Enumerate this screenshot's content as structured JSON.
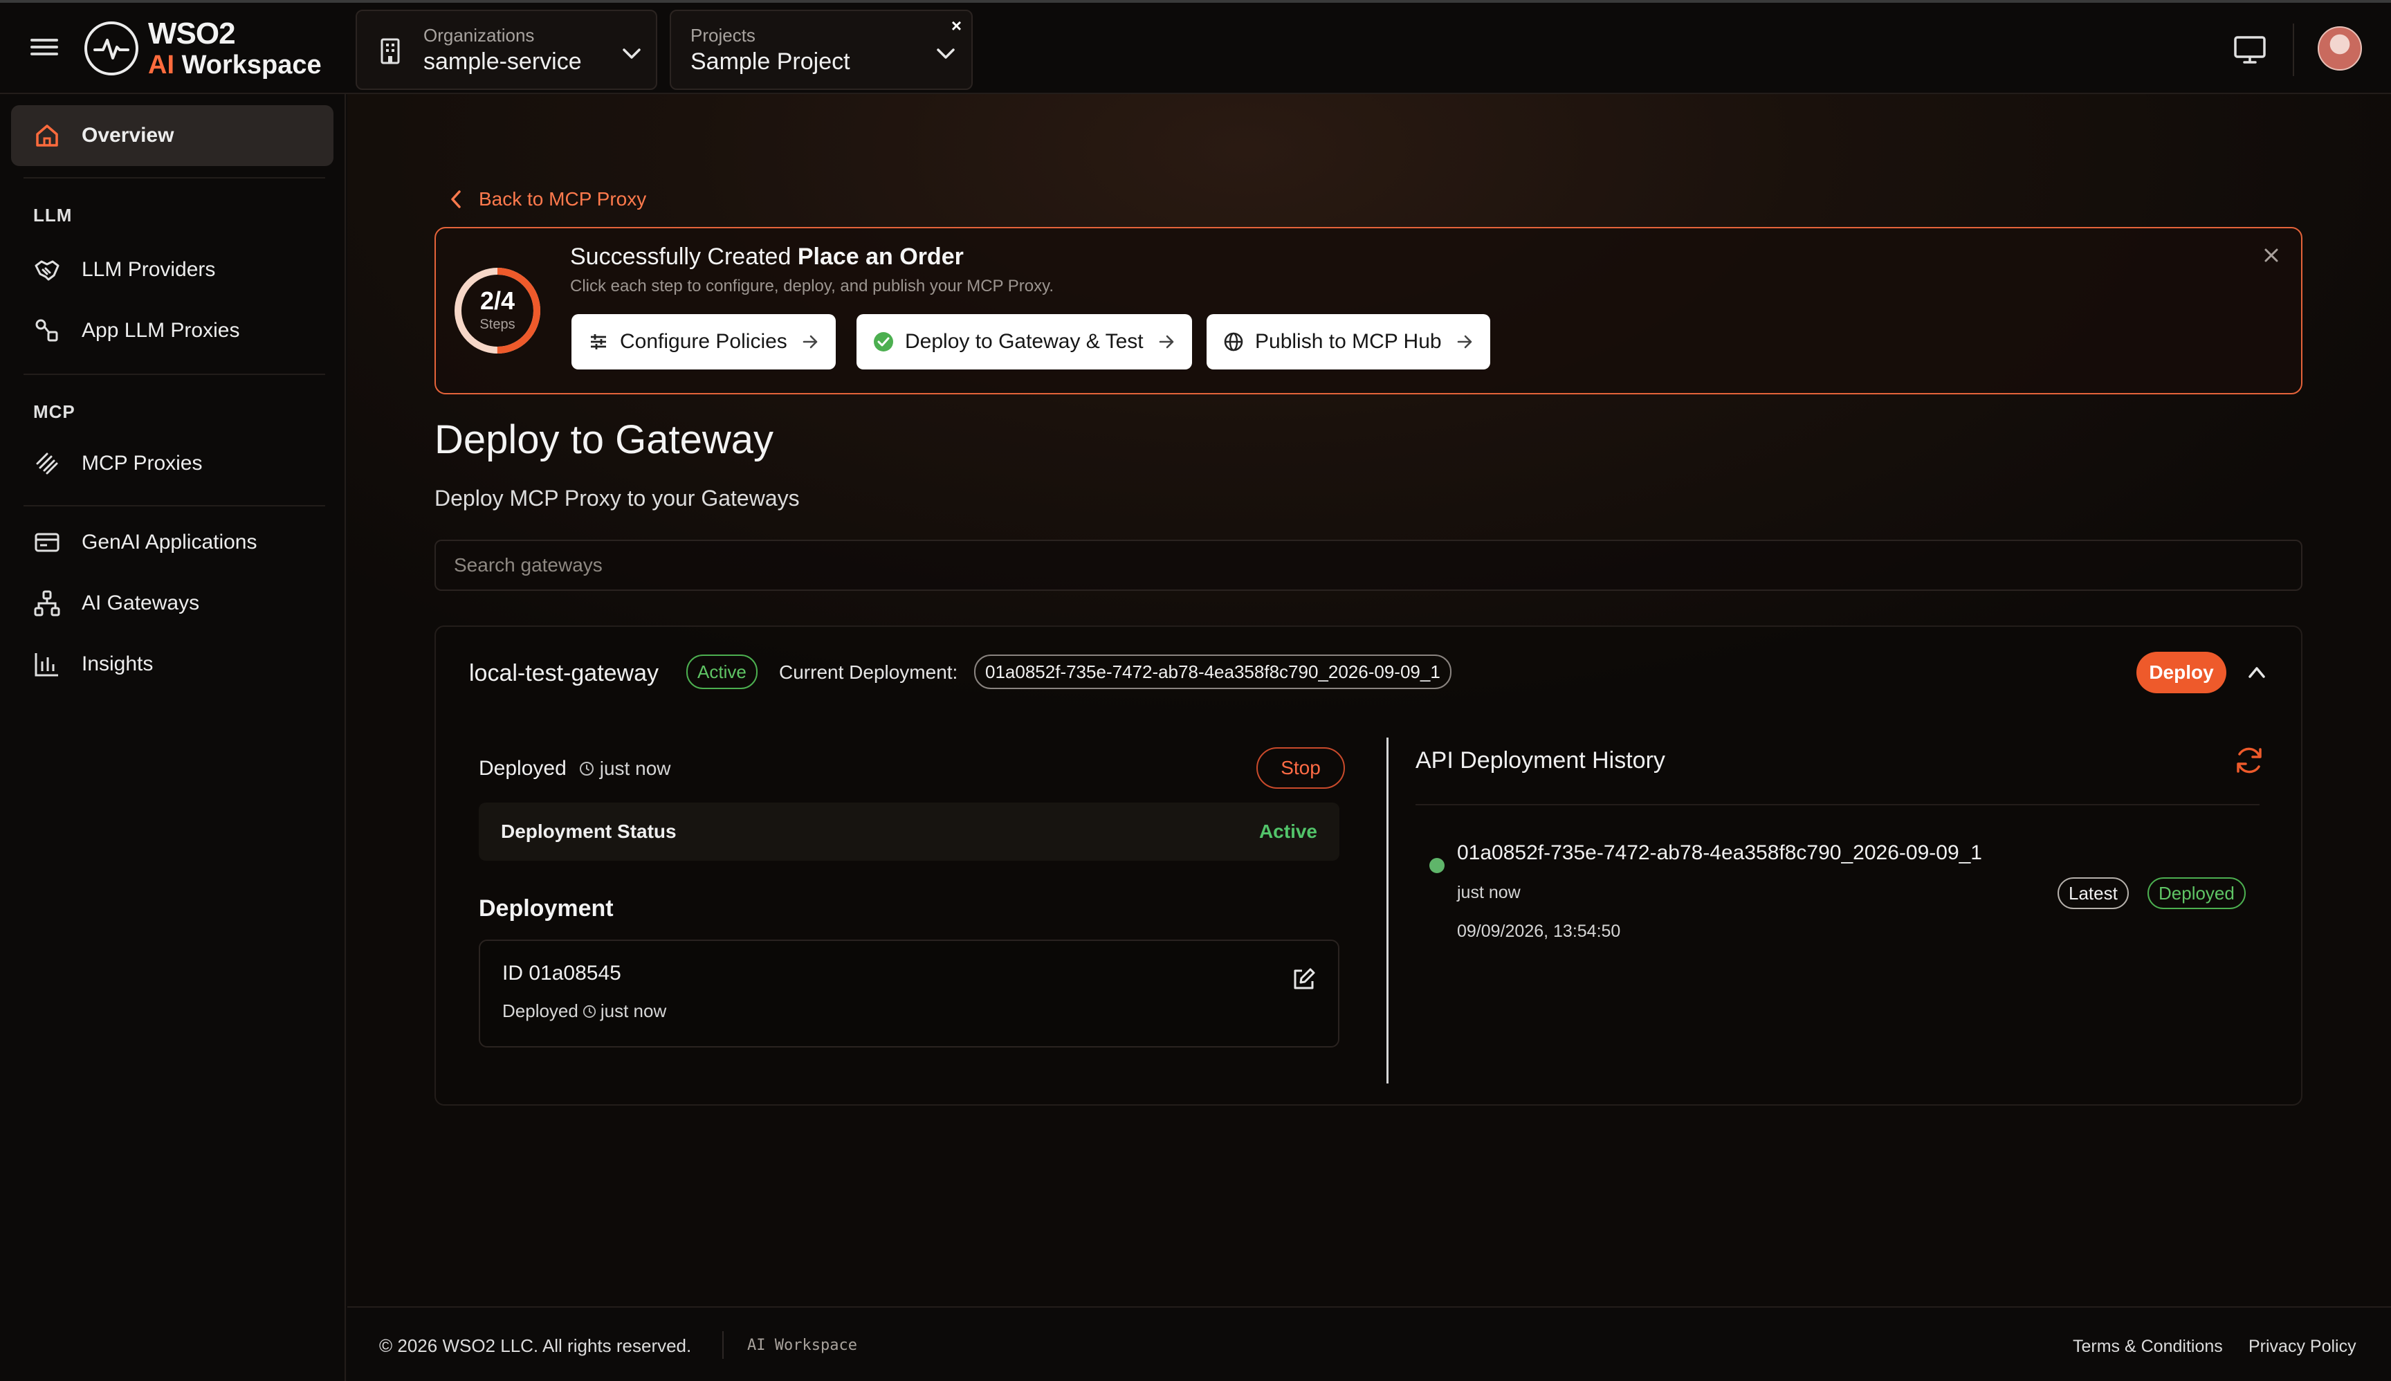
{
  "header": {
    "logo_line1": "WSO2",
    "logo_ai": "AI",
    "logo_word": "Workspace",
    "org_label": "Organizations",
    "org_value": "sample-service",
    "project_label": "Projects",
    "project_value": "Sample Project",
    "project_clear": "×"
  },
  "sidebar": {
    "overview": "Overview",
    "section_llm": "LLM",
    "llm_providers": "LLM Providers",
    "app_llm_proxies": "App LLM Proxies",
    "section_mcp": "MCP",
    "mcp_proxies": "MCP Proxies",
    "genai_applications": "GenAI Applications",
    "ai_gateways": "AI Gateways",
    "insights": "Insights"
  },
  "main": {
    "back_link": "Back to MCP Proxy",
    "banner": {
      "progress_text": "2/4",
      "progress_sub": "Steps",
      "steps_done": 2,
      "steps_total": 4,
      "title_prefix": "Successfully Created",
      "title_name": "Place an Order",
      "subtitle": "Click each step to configure, deploy, and publish your MCP Proxy.",
      "step1": "Configure Policies",
      "step2": "Deploy to Gateway & Test",
      "step3": "Publish to MCP Hub"
    },
    "page_title": "Deploy to Gateway",
    "page_subtitle": "Deploy MCP Proxy to your Gateways",
    "search_placeholder": "Search gateways",
    "gateway": {
      "name": "local-test-gateway",
      "status": "Active",
      "current_deployment_label": "Current Deployment:",
      "current_deployment_value": "01a0852f-735e-7472-ab78-4ea358f8c790_2026-09-09_1",
      "deploy_button": "Deploy",
      "deployed_label": "Deployed",
      "deployed_time": "just now",
      "stop_button": "Stop",
      "deployment_status_label": "Deployment Status",
      "deployment_status_value": "Active",
      "deployment_heading": "Deployment",
      "deployment_id": "ID 01a08545",
      "deployment_deployed_label": "Deployed",
      "deployment_deployed_time": "just now"
    },
    "history": {
      "title": "API Deployment History",
      "entry_id": "01a0852f-735e-7472-ab78-4ea358f8c790_2026-09-09_1",
      "entry_time": "just now",
      "entry_date": "09/09/2026, 13:54:50",
      "tag_latest": "Latest",
      "tag_deployed": "Deployed"
    }
  },
  "footer": {
    "copyright": "© 2026 WSO2 LLC. All rights reserved.",
    "brand": "AI Workspace",
    "terms": "Terms & Conditions",
    "privacy": "Privacy Policy"
  },
  "colors": {
    "accent": "#ee5a2b",
    "success": "#52c46a",
    "background": "#0d0b0a"
  },
  "icons": {
    "menu": "hamburger-icon",
    "org": "building-icon",
    "overview": "home-icon",
    "llm_providers": "handshake-icon",
    "app_llm_proxies": "proxy-link-icon",
    "mcp_proxies": "mcp-icon",
    "genai_applications": "card-icon",
    "ai_gateways": "network-icon",
    "insights": "bar-chart-icon",
    "monitor": "monitor-icon",
    "refresh": "refresh-icon",
    "edit": "edit-icon"
  }
}
